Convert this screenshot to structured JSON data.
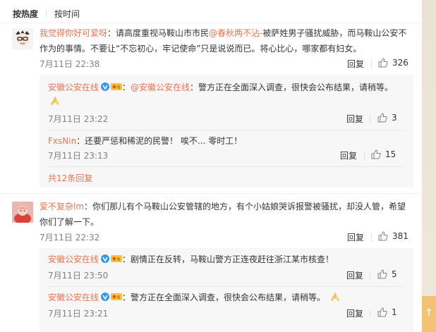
{
  "sort_tabs": {
    "hot": "按热度",
    "time": "按时间"
  },
  "colors": {
    "link": "#eb7350",
    "meta": "#808080",
    "subBg": "#f7f7f7"
  },
  "comments": [
    {
      "user": "我觉得你好可爱呀",
      "text_a": "：请高度重视马鞍山市市民",
      "mention": "@春秋两不沾-",
      "text_b": "被萨姓男子骚扰威胁，而马鞍山公安不作为的事情。不要让“不忘初心，牢记使命”只是说说而已。将心比心，哪家都有妇女。",
      "time": "7月11日 22:38",
      "reply": "回复",
      "likes": "326",
      "replies": [
        {
          "user": "安徽公安在线",
          "sep": "：",
          "mention": "@安徽公安在线",
          "text": "：警方正在全面深入调查，很快会公布结果，请稍等。",
          "time": "7月11日 23:22",
          "reply": "回复",
          "likes": "3"
        },
        {
          "user": "FxsNin",
          "text": "：还要严惩和稀泥的民警！ 唉不... 零时工！",
          "time": "7月11日 23:13",
          "reply": "回复",
          "likes": "15"
        }
      ],
      "expand": "共12条回复"
    },
    {
      "user": "爱不复杂lm",
      "text": "：你们那儿有个马鞍山公安管辖的地方，有个小姑娘哭诉报警被骚扰，却没人管，希望你们了解一下。",
      "time": "7月11日 22:32",
      "reply": "回复",
      "likes": "381",
      "replies": [
        {
          "user": "安徽公安在线",
          "text": "：剧情正在反转，马鞍山警方正连夜赶往浙江某市核查！",
          "time": "7月11日 23:50",
          "reply": "回复",
          "likes": "5"
        },
        {
          "user": "安徽公安在线",
          "text": "：警方正在全面深入调查，很快会公布结果，请稍等。",
          "time": "7月11日 23:21",
          "reply": "回复",
          "likes": "1"
        }
      ]
    }
  ]
}
